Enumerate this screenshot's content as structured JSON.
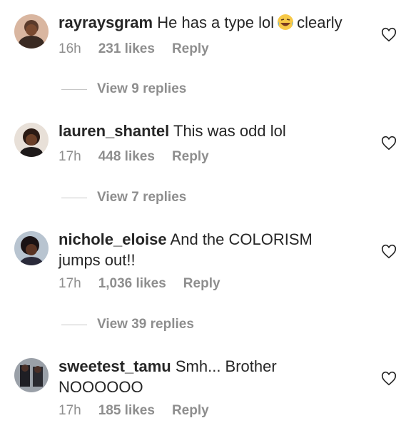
{
  "comments": [
    {
      "username": "rayraysgram",
      "text_before": "He has a type lol",
      "emoji": "laughing-tears-emoji",
      "text_after": "clearly",
      "time": "16h",
      "likes": "231 likes",
      "reply": "Reply",
      "view_replies": "View 9 replies"
    },
    {
      "username": "lauren_shantel",
      "text": "This was odd lol",
      "time": "17h",
      "likes": "448 likes",
      "reply": "Reply",
      "view_replies": "View 7 replies"
    },
    {
      "username": "nichole_eloise",
      "text": "And the COLORISM jumps out!!",
      "time": "17h",
      "likes": "1,036 likes",
      "reply": "Reply",
      "view_replies": "View 39 replies"
    },
    {
      "username": "sweetest_tamu",
      "text": "Smh... Brother NOOOOOO",
      "time": "17h",
      "likes": "185 likes",
      "reply": "Reply"
    }
  ],
  "colors": {
    "text": "#262626",
    "secondary": "#8e8e8e",
    "heart_stroke": "#262626"
  }
}
